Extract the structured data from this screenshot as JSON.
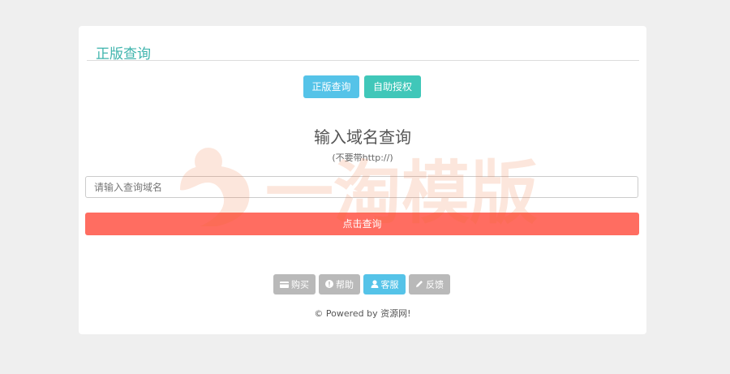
{
  "card": {
    "title": "正版查询"
  },
  "top_buttons": {
    "verify": "正版查询",
    "auth": "自助授权"
  },
  "main": {
    "heading": "输入域名查询",
    "subheading": "(不要带http://)",
    "input_placeholder": "请输入查询域名",
    "query_button": "点击查询"
  },
  "bottom_buttons": {
    "buy": "购买",
    "help": "帮助",
    "service": "客服",
    "feedback": "反馈"
  },
  "footer": {
    "text": "© Powered by 资源网!"
  },
  "watermark": {
    "text": "一淘模版"
  },
  "colors": {
    "accent_teal": "#3fb4ad",
    "button_blue": "#55c3e8",
    "button_teal": "#40c7b9",
    "button_red": "#ff6d61",
    "button_grey": "#b9b9b9"
  }
}
